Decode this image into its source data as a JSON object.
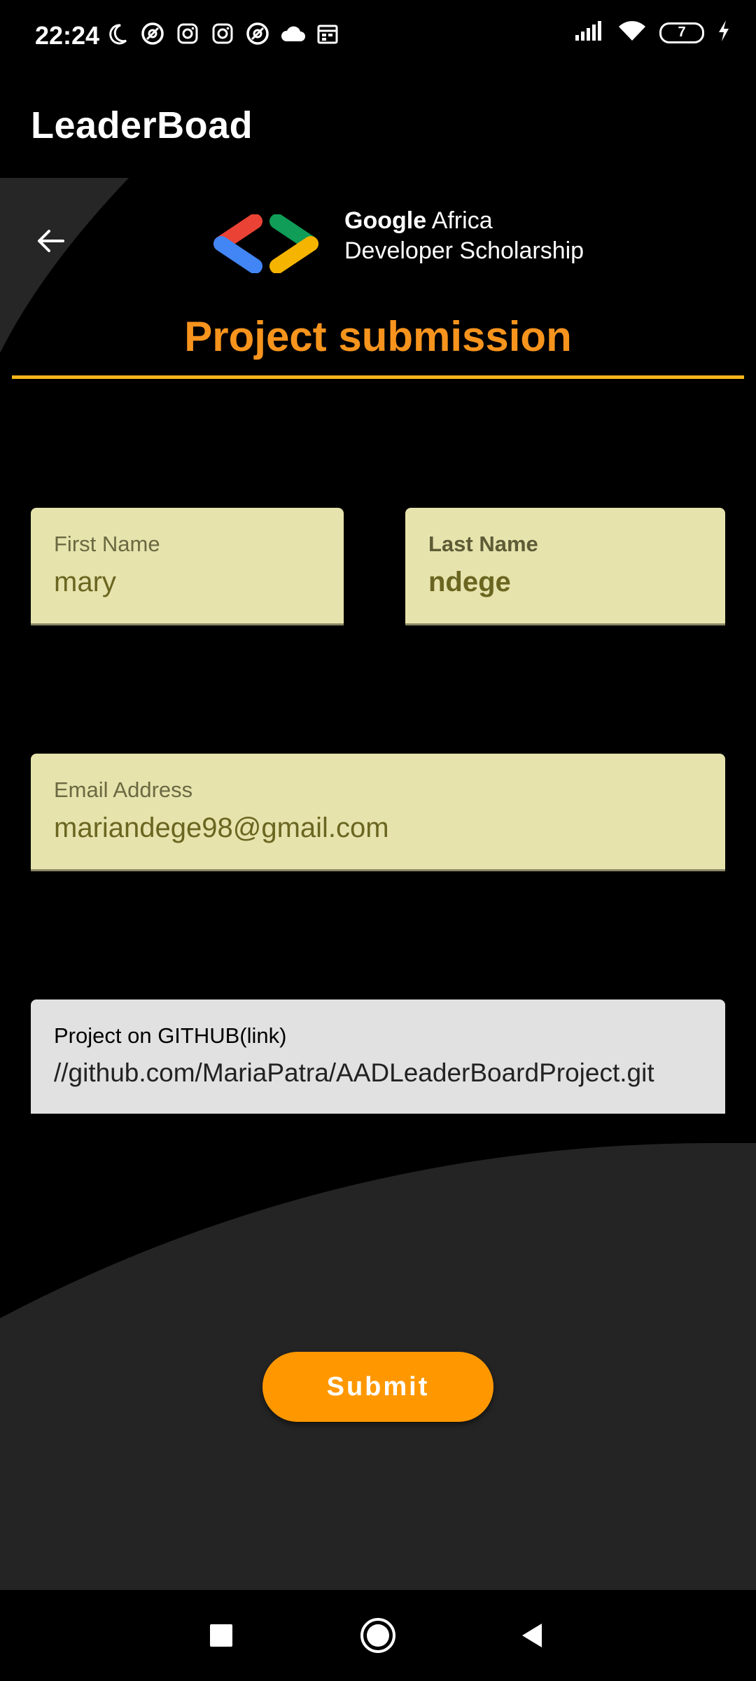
{
  "status_bar": {
    "time": "22:24",
    "left_icons": [
      "moon-icon",
      "at-sign-icon",
      "instagram-icon",
      "instagram-icon",
      "at-sign-icon",
      "cloud-icon",
      "calendar-icon"
    ],
    "battery_level": "7",
    "right_icons": [
      "signal-icon",
      "wifi-icon",
      "battery-icon",
      "charging-icon"
    ]
  },
  "app_bar": {
    "title": "LeaderBoad"
  },
  "header": {
    "brand_line1_bold": "Google",
    "brand_line1_rest": "Africa",
    "brand_line2": "Developer Scholarship",
    "title": "Project submission",
    "colors": {
      "accent": "#f7941d",
      "rule": "#f7b51c"
    }
  },
  "form": {
    "first_name": {
      "label": "First Name",
      "value": "mary"
    },
    "last_name": {
      "label": "Last Name",
      "value": "ndege"
    },
    "email": {
      "label": "Email Address",
      "value": "mariandege98@gmail.com"
    },
    "github": {
      "label": "Project on GITHUB(link)",
      "value": "//github.com/MariaPatra/AADLeaderBoardProject.git"
    },
    "submit_label": "Submit"
  },
  "nav_bar": {
    "icons": [
      "recents-square-icon",
      "home-circle-icon",
      "back-triangle-icon"
    ]
  }
}
